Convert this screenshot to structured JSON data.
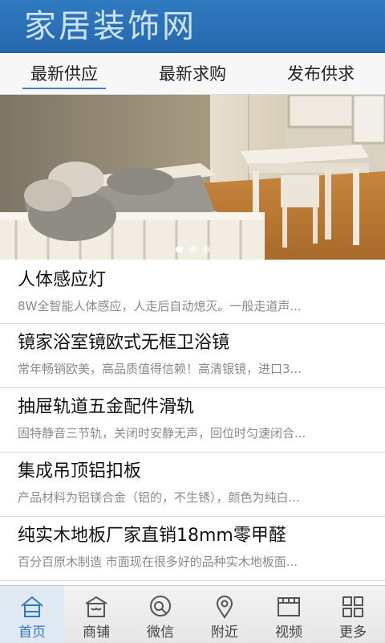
{
  "app": {
    "title": "家居装饰网",
    "accent": "#2f7ac0"
  },
  "tabs": [
    {
      "label": "最新供应",
      "active": true
    },
    {
      "label": "最新求购",
      "active": false
    },
    {
      "label": "发布供求",
      "active": false
    }
  ],
  "banner": {
    "slides": 3,
    "active_slide": 1
  },
  "list": [
    {
      "title": "人体感应灯",
      "desc": "8W全智能人体感应，人走后自动熄灭。一般走道声..."
    },
    {
      "title": "镜家浴室镜欧式无框卫浴镜",
      "desc": "常年畅销欧美，高品质值得信赖！高清银镜，进口3..."
    },
    {
      "title": "抽屉轨道五金配件滑轨",
      "desc": "固特静音三节轨，关闭时安静无声，回位时匀速闭合..."
    },
    {
      "title": "集成吊顶铝扣板",
      "desc": "产品材料为铝镁合金（铝的，不生锈），颜色为纯白..."
    },
    {
      "title": "纯实木地板厂家直销18mm零甲醛",
      "desc": "百分百原木制造 市面现在很多好的品种实木地板面..."
    }
  ],
  "bottom_nav": [
    {
      "label": "首页",
      "icon": "home-icon",
      "active": true
    },
    {
      "label": "商铺",
      "icon": "shop-icon",
      "active": false
    },
    {
      "label": "微信",
      "icon": "wechat-icon",
      "active": false
    },
    {
      "label": "附近",
      "icon": "location-pin-icon",
      "active": false
    },
    {
      "label": "视频",
      "icon": "video-icon",
      "active": false
    },
    {
      "label": "更多",
      "icon": "grid-icon",
      "active": false
    }
  ]
}
